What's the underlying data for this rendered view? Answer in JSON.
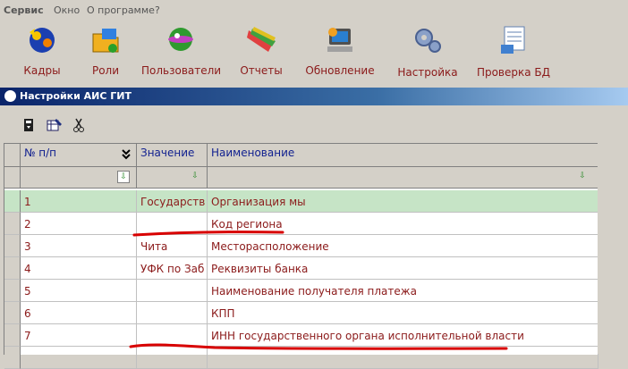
{
  "menu": [
    "Сервис",
    "Окно",
    "О программе",
    "?"
  ],
  "toolbar": [
    {
      "label": "Кадры",
      "icon": "personnel-icon"
    },
    {
      "label": "Роли",
      "icon": "roles-folder-icon"
    },
    {
      "label": "Пользователи",
      "icon": "users-icon"
    },
    {
      "label": "Отчеты",
      "icon": "reports-icon"
    },
    {
      "label": "Обновление",
      "icon": "update-computer-icon"
    },
    {
      "label": "Настройка",
      "icon": "settings-gears-icon"
    },
    {
      "label": "Проверка БД",
      "icon": "db-check-icon"
    }
  ],
  "window": {
    "title": "Настройки АИС ГИТ"
  },
  "grid": {
    "headers": [
      "№ п/п",
      "Значение",
      "Наименование"
    ],
    "rows": [
      {
        "num": "1",
        "value": "Государств",
        "name": "Организация мы"
      },
      {
        "num": "2",
        "value": "",
        "name": "Код региона"
      },
      {
        "num": "3",
        "value": "Чита",
        "name": "Месторасположение"
      },
      {
        "num": "4",
        "value": "УФК по Заб",
        "name": "Реквизиты банка"
      },
      {
        "num": "5",
        "value": "",
        "name": "Наименование получателя платежа"
      },
      {
        "num": "6",
        "value": "",
        "name": "КПП"
      },
      {
        "num": "7",
        "value": "",
        "name": "ИНН государственного органа исполнительной власти"
      }
    ]
  },
  "colors": {
    "accent": "#8b1a1a",
    "selected_row": "#c6e4c6",
    "title_blue": "#0a246a",
    "annotation_red": "#d80000"
  }
}
